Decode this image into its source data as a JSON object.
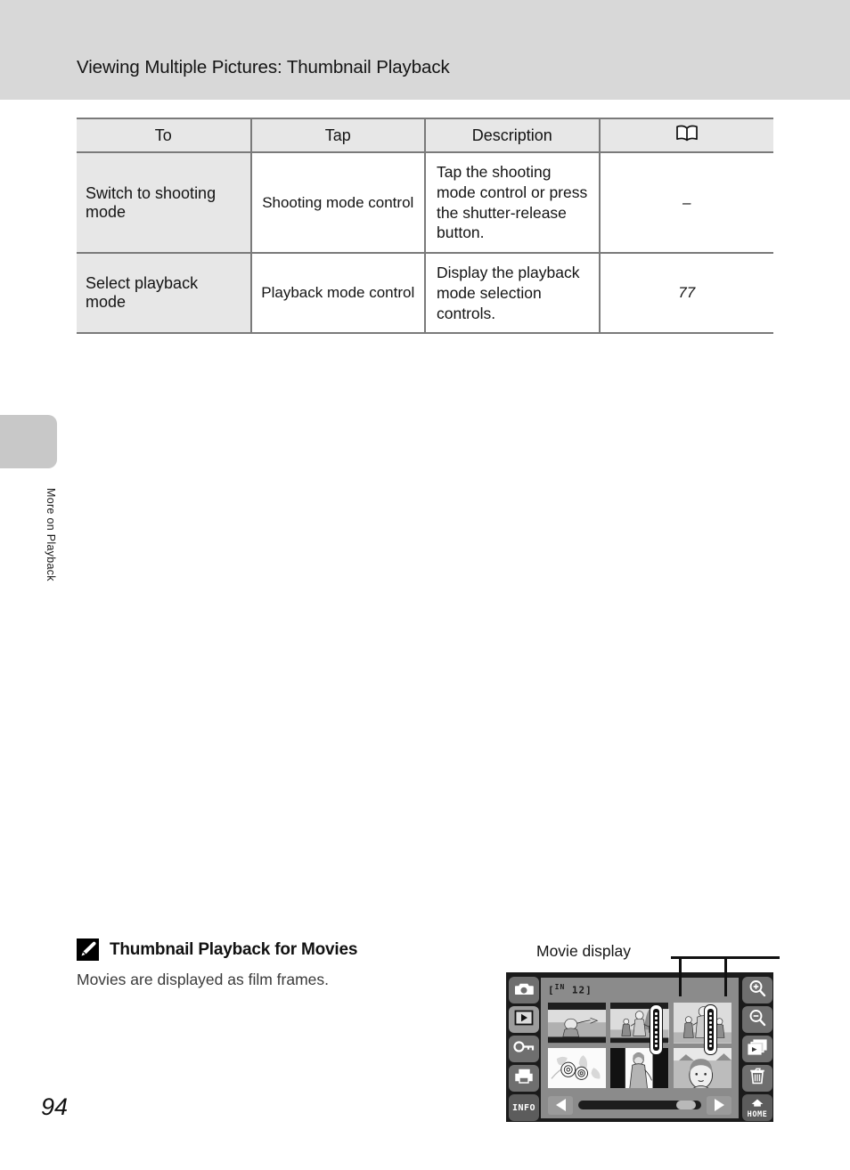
{
  "page": {
    "header_title": "Viewing Multiple Pictures: Thumbnail Playback",
    "side_tab_label": "More on Playback",
    "page_number": "94"
  },
  "table": {
    "headers": {
      "to": "To",
      "tap": "Tap",
      "description": "Description",
      "reference_icon": "open-book-icon"
    },
    "rows": [
      {
        "to": "Switch to shooting mode",
        "tap": "Shooting mode control",
        "description": "Tap the shooting mode control or press the shutter-release button.",
        "reference": "–"
      },
      {
        "to": "Select playback mode",
        "tap": "Playback mode control",
        "description": "Display the playback mode selection controls.",
        "reference": "77"
      }
    ]
  },
  "note": {
    "icon": "pencil-icon",
    "title": "Thumbnail Playback for Movies",
    "body": "Movies are displayed as film frames."
  },
  "illustration": {
    "callout_label": "Movie display",
    "indicator_prefix": "IN",
    "indicator_count": "12",
    "indicator_open": "[",
    "indicator_close": "]",
    "left_buttons": [
      {
        "name": "shooting-mode-button",
        "icon": "camera-icon",
        "label": ""
      },
      {
        "name": "playback-mode-button",
        "icon": "play-icon",
        "label": ""
      },
      {
        "name": "protect-button",
        "icon": "key-icon",
        "label": ""
      },
      {
        "name": "print-order-button",
        "icon": "printer-icon",
        "label": ""
      },
      {
        "name": "info-button",
        "icon": "info-icon",
        "label": "INFO"
      }
    ],
    "right_buttons": [
      {
        "name": "zoom-in-button",
        "icon": "magnifier-plus-icon",
        "label": ""
      },
      {
        "name": "zoom-out-button",
        "icon": "magnifier-minus-icon",
        "label": ""
      },
      {
        "name": "thumbnail-list-button",
        "icon": "multi-frame-icon",
        "label": ""
      },
      {
        "name": "delete-button",
        "icon": "trash-icon",
        "label": ""
      },
      {
        "name": "home-button",
        "icon": "home-icon",
        "label": "HOME"
      }
    ],
    "scroll": {
      "prev": "◀",
      "next": "▶"
    },
    "thumbnails": [
      {
        "name": "thumbnail-1",
        "subject": "person-outdoors"
      },
      {
        "name": "thumbnail-2",
        "subject": "two-people-walking"
      },
      {
        "name": "thumbnail-3",
        "subject": "family-group"
      },
      {
        "name": "thumbnail-4",
        "subject": "flowers"
      },
      {
        "name": "thumbnail-5",
        "subject": "person-portrait"
      },
      {
        "name": "thumbnail-6",
        "subject": "woman-at-beach"
      }
    ]
  },
  "colors": {
    "header_band": "#d8d8d8",
    "table_border": "#7a7a7a",
    "table_shade": "#e7e7e7",
    "side_tab": "#c8c8c8",
    "camera_body": "#1b1b1b",
    "screen": "#8b8b8b"
  }
}
